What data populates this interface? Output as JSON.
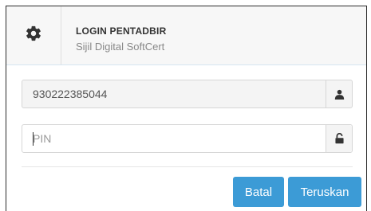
{
  "header": {
    "icon": "gear-icon",
    "title": "LOGIN PENTADBIR",
    "subtitle": "Sijil Digital SoftCert"
  },
  "form": {
    "username": {
      "value": "930222385044",
      "icon": "user-icon"
    },
    "pin": {
      "value": "",
      "placeholder": "PIN",
      "icon": "unlock-icon"
    }
  },
  "actions": {
    "cancel_label": "Batal",
    "next_label": "Teruskan"
  },
  "colors": {
    "primary": "#3c9bd6",
    "header_bg": "#f7f7f7"
  }
}
